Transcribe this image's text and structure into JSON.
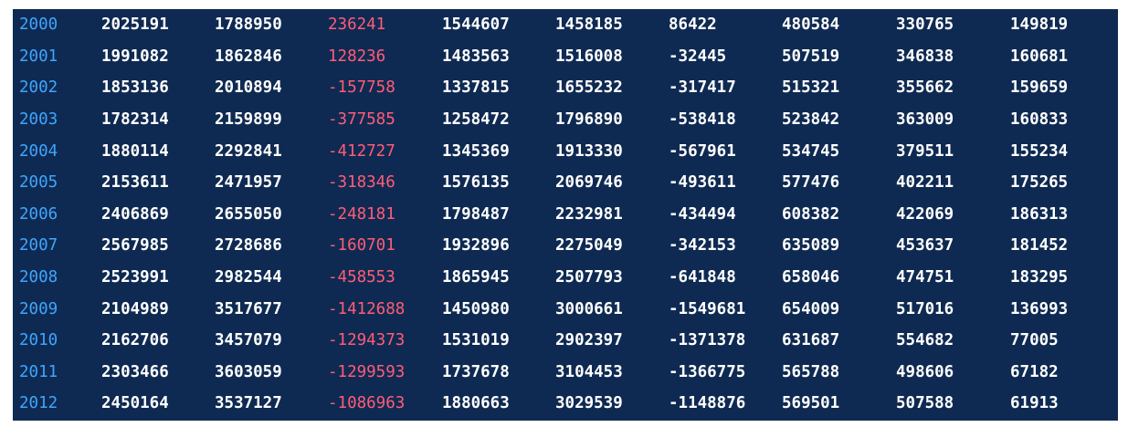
{
  "table": {
    "rows": [
      [
        "2000",
        "2025191",
        "1788950",
        "236241",
        "1544607",
        "1458185",
        "86422",
        "480584",
        "330765",
        "149819"
      ],
      [
        "2001",
        "1991082",
        "1862846",
        "128236",
        "1483563",
        "1516008",
        "-32445",
        "507519",
        "346838",
        "160681"
      ],
      [
        "2002",
        "1853136",
        "2010894",
        "-157758",
        "1337815",
        "1655232",
        "-317417",
        "515321",
        "355662",
        "159659"
      ],
      [
        "2003",
        "1782314",
        "2159899",
        "-377585",
        "1258472",
        "1796890",
        "-538418",
        "523842",
        "363009",
        "160833"
      ],
      [
        "2004",
        "1880114",
        "2292841",
        "-412727",
        "1345369",
        "1913330",
        "-567961",
        "534745",
        "379511",
        "155234"
      ],
      [
        "2005",
        "2153611",
        "2471957",
        "-318346",
        "1576135",
        "2069746",
        "-493611",
        "577476",
        "402211",
        "175265"
      ],
      [
        "2006",
        "2406869",
        "2655050",
        "-248181",
        "1798487",
        "2232981",
        "-434494",
        "608382",
        "422069",
        "186313"
      ],
      [
        "2007",
        "2567985",
        "2728686",
        "-160701",
        "1932896",
        "2275049",
        "-342153",
        "635089",
        "453637",
        "181452"
      ],
      [
        "2008",
        "2523991",
        "2982544",
        "-458553",
        "1865945",
        "2507793",
        "-641848",
        "658046",
        "474751",
        "183295"
      ],
      [
        "2009",
        "2104989",
        "3517677",
        "-1412688",
        "1450980",
        "3000661",
        "-1549681",
        "654009",
        "517016",
        "136993"
      ],
      [
        "2010",
        "2162706",
        "3457079",
        "-1294373",
        "1531019",
        "2902397",
        "-1371378",
        "631687",
        "554682",
        "77005"
      ],
      [
        "2011",
        "2303466",
        "3603059",
        "-1299593",
        "1737678",
        "3104453",
        "-1366775",
        "565788",
        "498606",
        "67182"
      ],
      [
        "2012",
        "2450164",
        "3537127",
        "-1086963",
        "1880663",
        "3029539",
        "-1148876",
        "569501",
        "507588",
        "61913"
      ]
    ],
    "colors": {
      "background": "#0f2a52",
      "year": "#3ea6ff",
      "highlight": "#ff5c77",
      "text": "#ffffff"
    }
  }
}
